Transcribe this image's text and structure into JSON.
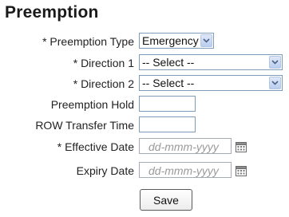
{
  "page": {
    "title": "Preemption"
  },
  "form": {
    "preemption_type": {
      "label": "* Preemption Type",
      "value": "Emergency"
    },
    "direction1": {
      "label": "* Direction 1",
      "value": "-- Select --"
    },
    "direction2": {
      "label": "* Direction 2",
      "value": "-- Select --"
    },
    "preemption_hold": {
      "label": "Preemption Hold",
      "value": ""
    },
    "row_transfer_time": {
      "label": "ROW Transfer Time",
      "value": ""
    },
    "effective_date": {
      "label": "* Effective Date",
      "placeholder": "dd-mmm-yyyy",
      "icon": "calendar-icon"
    },
    "expiry_date": {
      "label": "Expiry Date",
      "placeholder": "dd-mmm-yyyy",
      "icon": "calendar-icon"
    },
    "save_label": "Save"
  },
  "colors": {
    "field_border": "#7f9db9",
    "dropdown_arrow_bg": "#b9cdf0",
    "placeholder_text": "#9a9a9a"
  }
}
